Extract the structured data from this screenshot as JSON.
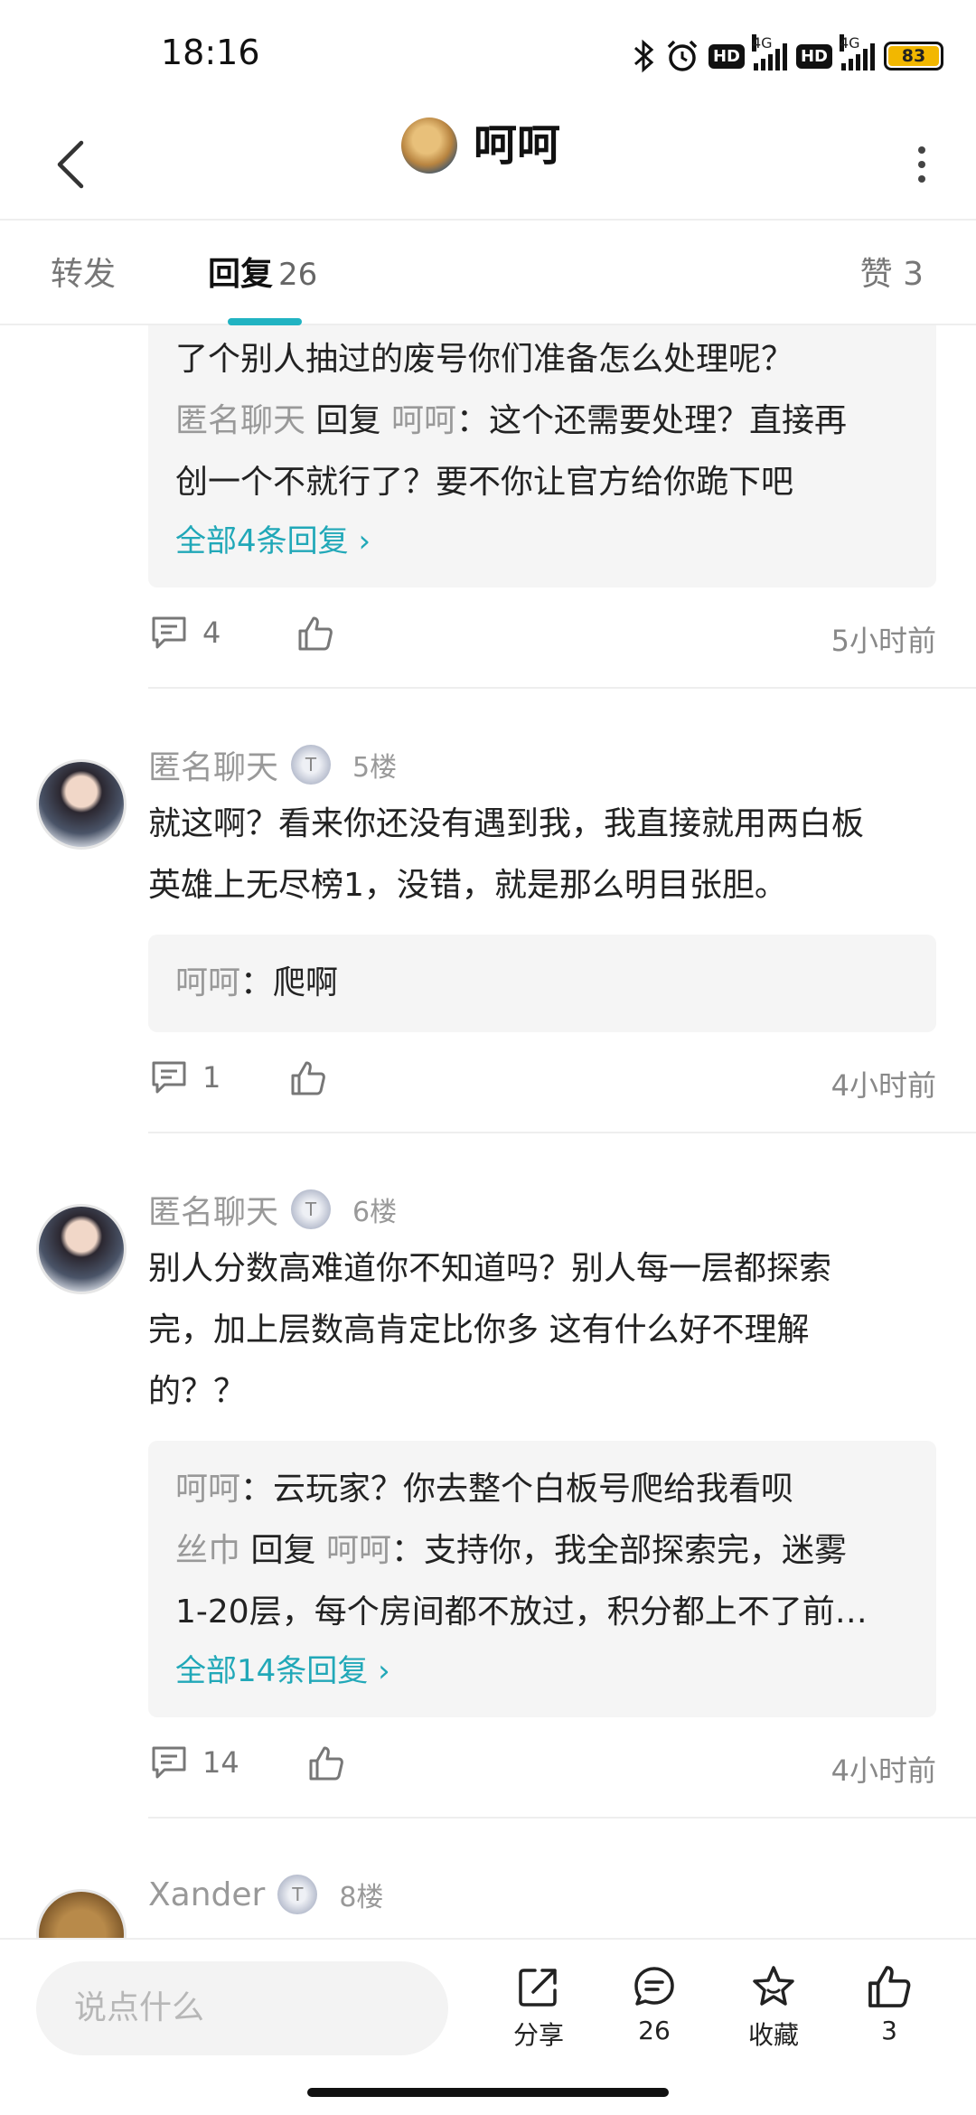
{
  "status_bar": {
    "time": "18:16",
    "battery": "83",
    "hd1": "HD",
    "hd2": "HD",
    "net1": "4G",
    "net2": "4G"
  },
  "header": {
    "title": "呵呵"
  },
  "tabs": {
    "forward": "转发",
    "replies": "回复",
    "replies_count": "26",
    "likes": "赞 3"
  },
  "top_snippet": {
    "line1": "了个别人抽过的废号你们准备怎么处理呢？",
    "reply": {
      "name": "匿名聊天",
      "verb": "回复",
      "target": "呵呵",
      "text": "：这个还需要处理？直接再"
    },
    "line3": "创一个不就行了？要不你让官方给你跪下吧",
    "more": "全部4条回复 ›",
    "comments": "4",
    "time": "5小时前"
  },
  "comments": [
    {
      "name": "匿名聊天",
      "floor": "5楼",
      "body": [
        "就这啊？看来你还没有遇到我，我直接就用两白板",
        "英雄上无尽榜1，没错，就是那么明目张胆。"
      ],
      "quote": {
        "name": "呵呵",
        "text": "：爬啊"
      },
      "comments": "1",
      "time": "4小时前"
    },
    {
      "name": "匿名聊天",
      "floor": "6楼",
      "body": [
        "别人分数高难道你不知道吗？别人每一层都探索",
        "完，加上层数高肯定比你多 这有什么好不理解",
        "的？？"
      ],
      "quote": {
        "name": "呵呵",
        "text": "：云玩家？你去整个白板号爬给我看呗"
      },
      "reply": {
        "name": "丝巾",
        "verb": "回复",
        "target": "呵呵",
        "text": "：支持你，我全部探索完，迷雾"
      },
      "reply_line2": "1-20层，每个房间都不放过，积分都上不了前…",
      "more": "全部14条回复 ›",
      "comments": "14",
      "time": "4小时前"
    },
    {
      "name": "Xander",
      "floor": "8楼"
    }
  ],
  "bottom_bar": {
    "placeholder": "说点什么",
    "share": "分享",
    "comments": "26",
    "favorite": "收藏",
    "likes": "3"
  },
  "colors": {
    "accent": "#21b3c2",
    "link": "#21a8b8"
  }
}
